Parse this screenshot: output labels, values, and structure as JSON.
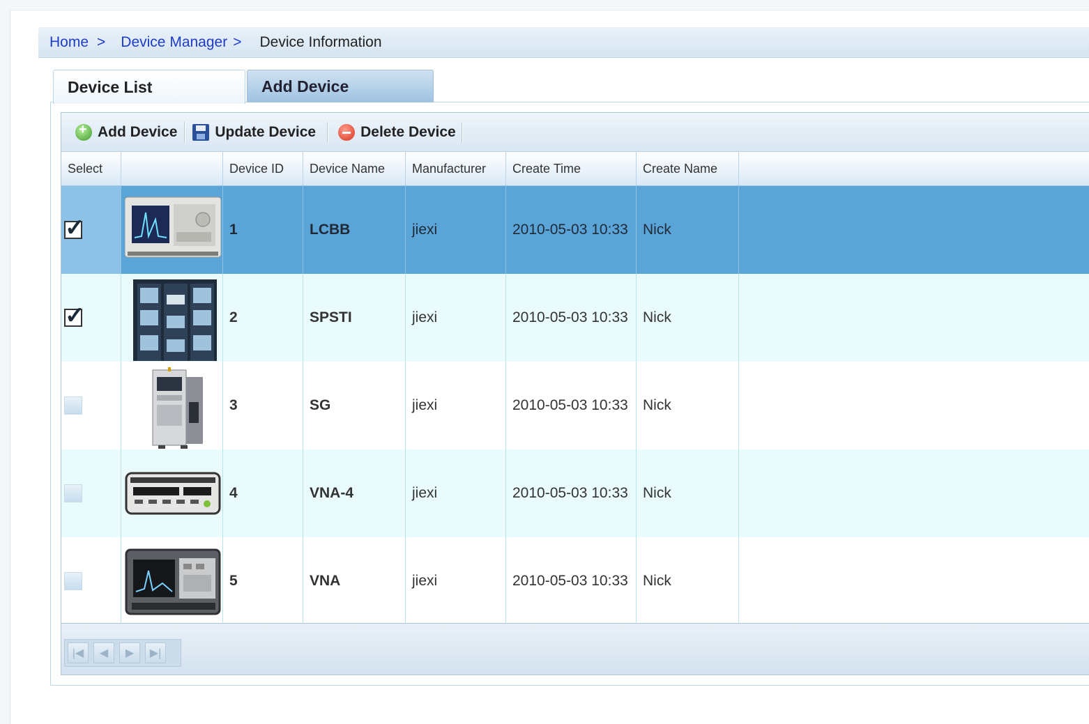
{
  "breadcrumb": {
    "home": "Home",
    "sep1": ">",
    "device_manager": "Device Manager",
    "sep2": ">",
    "current": "Device Information"
  },
  "tabs": [
    {
      "label": "Device List",
      "active": true
    },
    {
      "label": "Add Device",
      "active": false
    }
  ],
  "toolbar": {
    "add_label": "Add Device",
    "add_icon": "add-circle-icon",
    "update_label": "Update Device",
    "update_icon": "save-disk-icon",
    "delete_label": "Delete Device",
    "delete_icon": "delete-circle-icon"
  },
  "table": {
    "headers": [
      "Select",
      "",
      "Device ID",
      "Device Name",
      "Manufacturer",
      "Create Time",
      "Create Name"
    ],
    "rows": [
      {
        "checked": true,
        "selected": true,
        "id": "1",
        "name": "LCBB",
        "manufacturer": "jiexi",
        "create_time": "2010-05-03 10:33",
        "create_name": "Nick",
        "image": "network-analyzer"
      },
      {
        "checked": true,
        "selected": false,
        "id": "2",
        "name": "SPSTI",
        "manufacturer": "jiexi",
        "create_time": "2010-05-03 10:33",
        "create_name": "Nick",
        "image": "server-rack"
      },
      {
        "checked": false,
        "selected": false,
        "id": "3",
        "name": "SG",
        "manufacturer": "jiexi",
        "create_time": "2010-05-03 10:33",
        "create_name": "Nick",
        "image": "cabinet-tower"
      },
      {
        "checked": false,
        "selected": false,
        "id": "4",
        "name": "VNA-4",
        "manufacturer": "jiexi",
        "create_time": "2010-05-03 10:33",
        "create_name": "Nick",
        "image": "bench-meter"
      },
      {
        "checked": false,
        "selected": false,
        "id": "5",
        "name": "VNA",
        "manufacturer": "jiexi",
        "create_time": "2010-05-03 10:33",
        "create_name": "Nick",
        "image": "spectrum-analyzer"
      }
    ]
  },
  "pager": {
    "first_icon": "first-page-icon",
    "prev_icon": "prev-page-icon",
    "next_icon": "next-page-icon",
    "last_icon": "last-page-icon"
  },
  "colors": {
    "selected_row": "#5aa4d8",
    "alt_row": "#e9fbfc",
    "link": "#1f3cc8"
  }
}
